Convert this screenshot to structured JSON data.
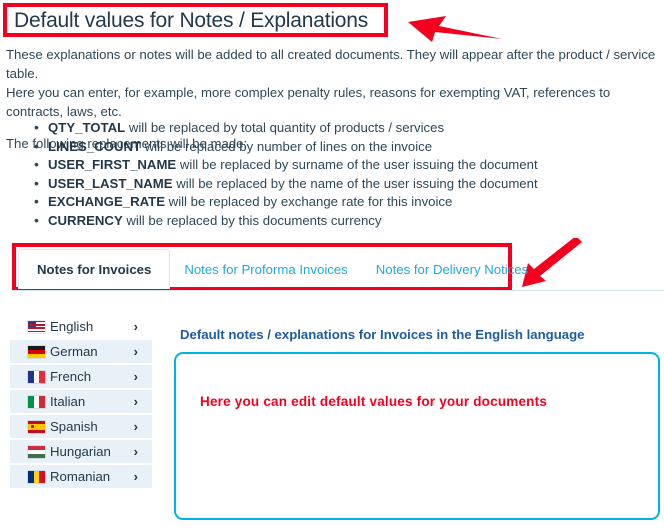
{
  "page": {
    "title": "Default values for Notes / Explanations"
  },
  "intro": {
    "line1": "These explanations or notes will be added to all created documents. They will appear after the product / service table.",
    "line2": "Here you can enter, for example, more complex penalty rules, reasons for exempting VAT, references to contracts, laws, etc.",
    "line3": "The following replacements will be made:"
  },
  "replacements": [
    {
      "code": "QTY_TOTAL",
      "desc": " will be replaced by total quantity of products / services"
    },
    {
      "code": "LINES_COUNT",
      "desc": " will be replaced by number of lines on the invoice"
    },
    {
      "code": "USER_FIRST_NAME",
      "desc": " will be replaced by surname of the user issuing the document"
    },
    {
      "code": "USER_LAST_NAME",
      "desc": " will be replaced by the name of the user issuing the document"
    },
    {
      "code": "EXCHANGE_RATE",
      "desc": " will be replaced by exchange rate for this invoice"
    },
    {
      "code": "CURRENCY",
      "desc": " will be replaced by this documents currency"
    }
  ],
  "tabs": [
    {
      "label": "Notes for Invoices",
      "active": true
    },
    {
      "label": "Notes for Proforma Invoices",
      "active": false
    },
    {
      "label": "Notes for Delivery Notices",
      "active": false
    }
  ],
  "languages": [
    {
      "name": "English",
      "flag": "flag-us",
      "chevron": "›"
    },
    {
      "name": "German",
      "flag": "flag-de",
      "chevron": "›"
    },
    {
      "name": "French",
      "flag": "flag-fr",
      "chevron": "›"
    },
    {
      "name": "Italian",
      "flag": "flag-it",
      "chevron": "›"
    },
    {
      "name": "Spanish",
      "flag": "flag-es",
      "chevron": "›"
    },
    {
      "name": "Hungarian",
      "flag": "flag-hu",
      "chevron": "›"
    },
    {
      "name": "Romanian",
      "flag": "flag-ro",
      "chevron": "›"
    }
  ],
  "editor": {
    "heading": "Default notes / explanations for Invoices in the English language",
    "content": "Here you can edit default values for your documents"
  },
  "annotations": {
    "title_box_color": "#f4001e",
    "tabs_box_color": "#f4001e",
    "arrow_color": "#f4001e",
    "arrow_title_name": "left-arrow",
    "arrow_tabs_name": "down-left-arrow"
  },
  "colors": {
    "accent_cyan": "#00b3e6",
    "link_blue": "#1fa9e0",
    "heading_blue": "#1f5c9e",
    "text": "#2e4858",
    "row_bg": "#e8f1f8"
  }
}
